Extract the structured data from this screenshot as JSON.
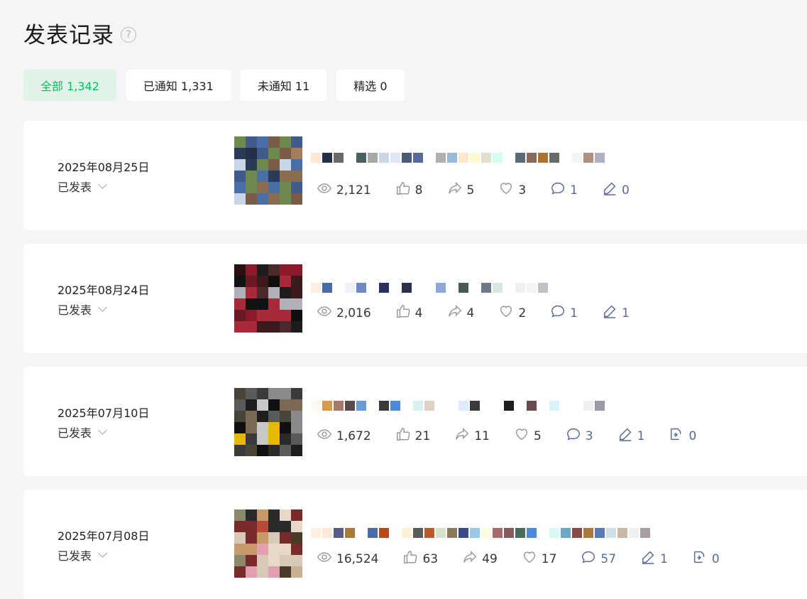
{
  "header": {
    "title": "发表记录",
    "help_glyph": "?"
  },
  "tabs": [
    {
      "label": "全部 1,342",
      "active": true
    },
    {
      "label": "已通知 1,331",
      "active": false
    },
    {
      "label": "未通知 11",
      "active": false
    },
    {
      "label": "精选 0",
      "active": false
    }
  ],
  "posts": [
    {
      "date": "2025年08月25日",
      "status": "已发表",
      "stats": {
        "views": "2,121",
        "likes": "8",
        "shares": "5",
        "favorites": "3",
        "comments": "1",
        "notes": "0"
      }
    },
    {
      "date": "2025年08月24日",
      "status": "已发表",
      "stats": {
        "views": "2,016",
        "likes": "4",
        "shares": "4",
        "favorites": "2",
        "comments": "1",
        "notes": "1"
      }
    },
    {
      "date": "2025年07月10日",
      "status": "已发表",
      "stats": {
        "views": "1,672",
        "likes": "21",
        "shares": "11",
        "favorites": "5",
        "comments": "3",
        "notes": "1",
        "reposts": "0"
      }
    },
    {
      "date": "2025年07月08日",
      "status": "已发表",
      "stats": {
        "views": "16,524",
        "likes": "63",
        "shares": "49",
        "favorites": "17",
        "comments": "57",
        "notes": "1",
        "reposts": "0"
      }
    }
  ],
  "colors": {
    "accent": "#07c160",
    "accent_bg": "#dff3e7",
    "link_blue": "#576b95",
    "page_bg": "#f4f5f7"
  },
  "icons": [
    "help-icon",
    "chevron-down-icon",
    "eye-icon",
    "thumbs-up-icon",
    "share-icon",
    "heart-icon",
    "comment-icon",
    "pen-icon",
    "repost-icon"
  ]
}
